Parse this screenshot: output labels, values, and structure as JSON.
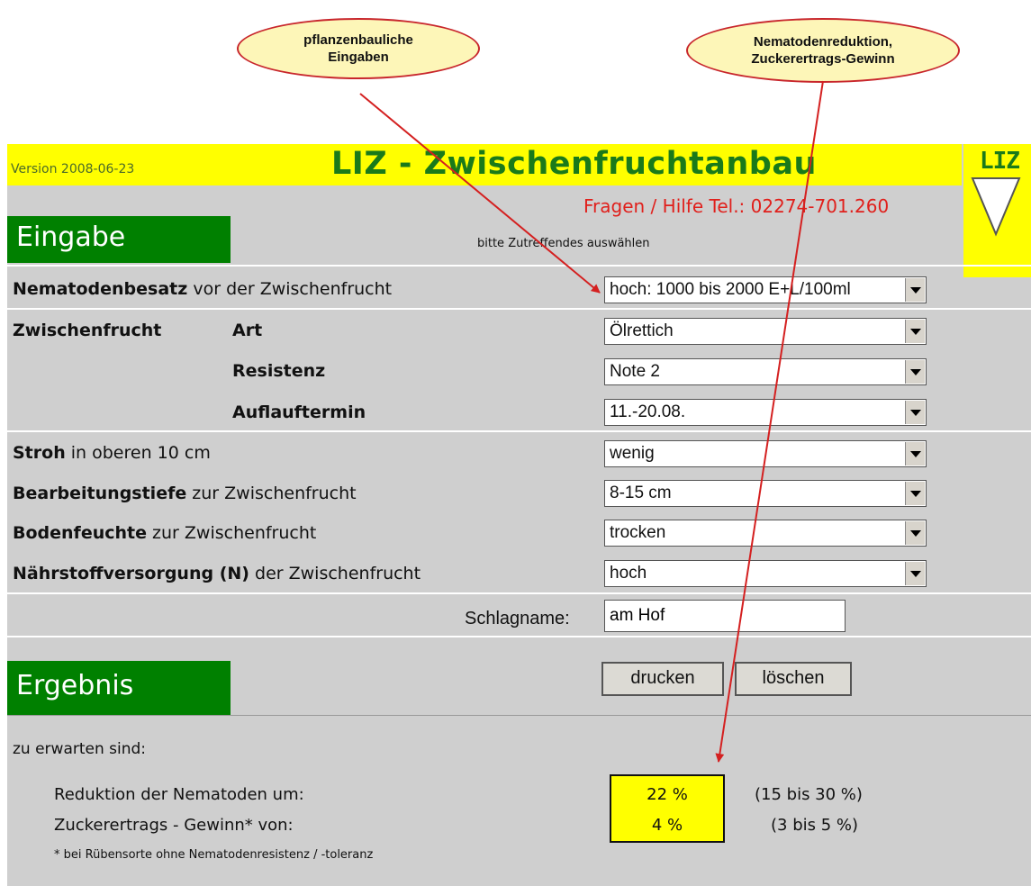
{
  "callouts": {
    "left": [
      "pflanzenbauliche",
      "Eingaben"
    ],
    "right": [
      "Nematodenreduktion,",
      "Zuckerertrags-Gewinn"
    ]
  },
  "header": {
    "version": "Version 2008-06-23",
    "title": "LIZ - Zwischenfruchtanbau",
    "logo_text": "LIZ",
    "help": "Fragen / Hilfe Tel.: 02274-701.260"
  },
  "eingabe": {
    "heading": "Eingabe",
    "hint": "bitte Zutreffendes auswählen",
    "nematoden": {
      "label_bold": "Nematodenbesatz",
      "label_rest": " vor der Zwischenfrucht",
      "value": "hoch: 1000 bis 2000 E+L/100ml"
    },
    "zwischenfrucht": {
      "label": "Zwischenfrucht"
    },
    "art": {
      "label": "Art",
      "value": "Ölrettich"
    },
    "resistenz": {
      "label": "Resistenz",
      "value": "Note 2"
    },
    "auflauf": {
      "label": "Auflauftermin",
      "value": "11.-20.08."
    },
    "stroh": {
      "label_bold": "Stroh",
      "label_rest": " in oberen 10 cm",
      "value": "wenig"
    },
    "bearbeitung": {
      "label_bold": "Bearbeitungstiefe",
      "label_rest": " zur Zwischenfrucht",
      "value": "8-15 cm"
    },
    "boden": {
      "label_bold": "Bodenfeuchte",
      "label_rest": " zur Zwischenfrucht",
      "value": "trocken"
    },
    "naehr": {
      "label_bold": "Nährstoffversorgung (N)",
      "label_rest": " der Zwischenfrucht",
      "value": "hoch"
    },
    "schlag": {
      "label": "Schlagname:",
      "value": "am Hof"
    }
  },
  "ergebnis": {
    "heading": "Ergebnis",
    "print_button": "drucken",
    "clear_button": "löschen",
    "expect": "zu erwarten sind:",
    "reduktion": {
      "label": "Reduktion der Nematoden um:",
      "value": "22 %",
      "range": "(15 bis 30 %)"
    },
    "zucker": {
      "label": "Zuckerertrags - Gewinn* von:",
      "value": "4 %",
      "range": "(3 bis 5 %)"
    },
    "footnote": "* bei Rübensorte ohne Nematodenresistenz / -toleranz"
  },
  "colors": {
    "header_yellow": "#ffff00",
    "section_green": "#008000",
    "title_green": "#1a7a1a",
    "help_red": "#e0201c",
    "arrow_red": "#d42020",
    "callout_fill": "#fdf6b8"
  }
}
